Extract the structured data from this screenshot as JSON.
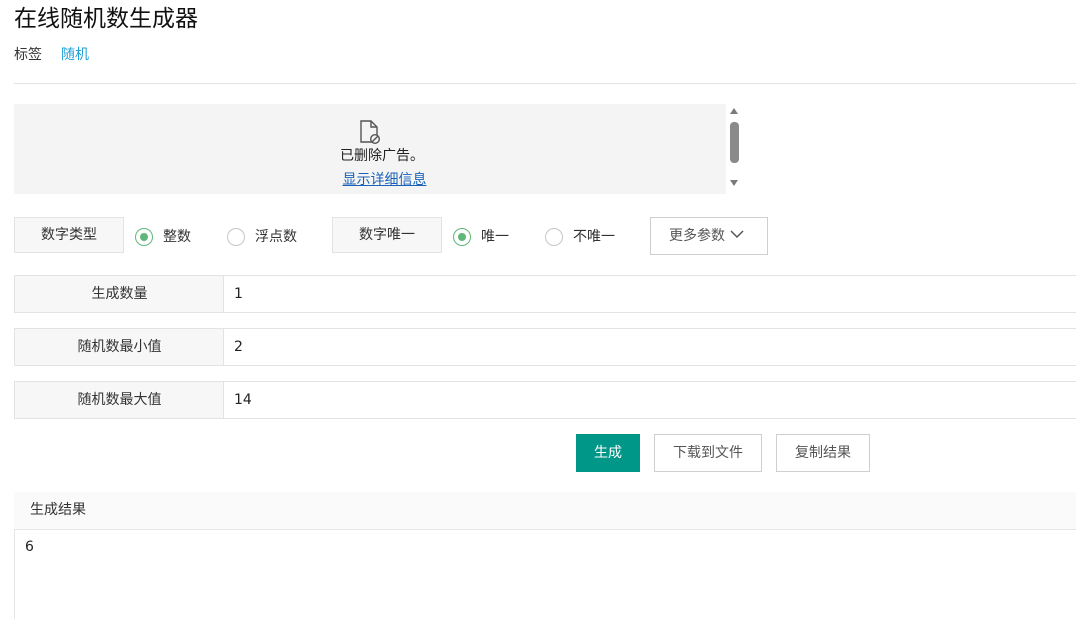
{
  "page": {
    "title": "在线随机数生成器"
  },
  "tags": {
    "label": "标签",
    "items": [
      "随机"
    ]
  },
  "ad": {
    "message": "已删除广告。",
    "details_link": "显示详细信息"
  },
  "options": {
    "number_type": {
      "label": "数字类型",
      "choices": [
        "整数",
        "浮点数"
      ],
      "selected": "整数"
    },
    "uniqueness": {
      "label": "数字唯一",
      "choices": [
        "唯一",
        "不唯一"
      ],
      "selected": "唯一"
    },
    "more_params": "更多参数"
  },
  "fields": {
    "count": {
      "label": "生成数量",
      "value": "1"
    },
    "min": {
      "label": "随机数最小值",
      "value": "2"
    },
    "max": {
      "label": "随机数最大值",
      "value": "14"
    }
  },
  "actions": {
    "generate": "生成",
    "download": "下载到文件",
    "copy": "复制结果"
  },
  "result": {
    "header": "生成结果",
    "value": "6"
  },
  "colors": {
    "primary": "#009688",
    "radio_checked": "#5fb878",
    "link": "#1f9fd6",
    "ad_link": "#1a62b8"
  }
}
